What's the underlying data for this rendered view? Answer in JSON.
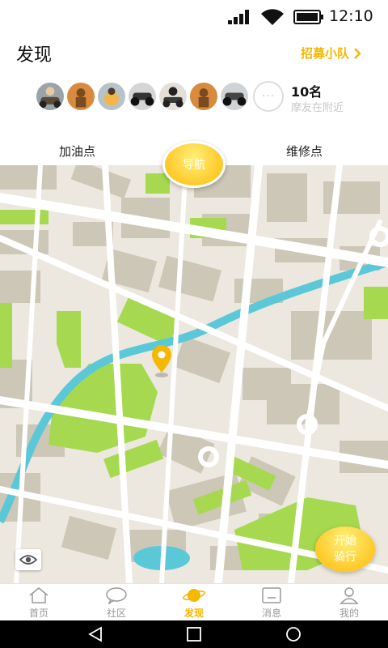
{
  "status_bar": {
    "time": "12:10"
  },
  "header": {
    "title": "发现",
    "recruit_label": "招募小队"
  },
  "riders": {
    "count_label": "10名",
    "nearby_label": "摩友在附近",
    "avatars": [
      "avatar-1",
      "avatar-2",
      "avatar-3",
      "avatar-4",
      "avatar-5",
      "avatar-6",
      "avatar-7"
    ],
    "more_symbol": "···"
  },
  "tabs": {
    "left": "加油点",
    "center": "导航",
    "right": "维修点"
  },
  "map": {
    "start_ride_label_line1": "开始",
    "start_ride_label_line2": "骑行"
  },
  "bottom_nav": {
    "items": [
      {
        "label": "首页",
        "icon": "home-icon"
      },
      {
        "label": "社区",
        "icon": "chat-bubble-icon"
      },
      {
        "label": "发现",
        "icon": "planet-icon",
        "active": true
      },
      {
        "label": "消息",
        "icon": "message-box-icon"
      },
      {
        "label": "我的",
        "icon": "user-icon"
      }
    ]
  },
  "colors": {
    "accent": "#f5b800",
    "map_green": "#a6d94f",
    "map_river": "#5bc8d8",
    "map_block": "#cdc7b8",
    "map_bg": "#ece8df"
  }
}
